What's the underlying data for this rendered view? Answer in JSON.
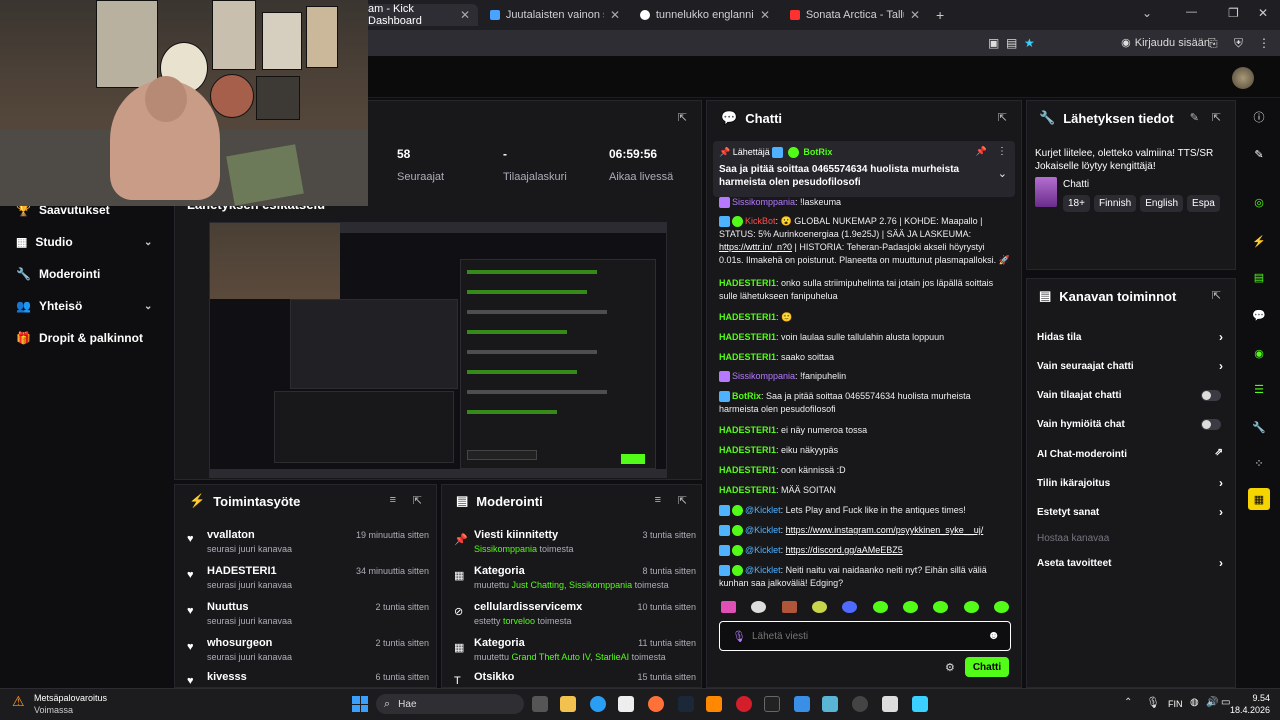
{
  "browser": {
    "tabs": [
      {
        "label": "am - Kick Dashboard",
        "close": "✕",
        "color": "#53fc18"
      },
      {
        "label": "Juutalaisten vainon syyt ja aikaj",
        "close": "✕",
        "color": "#4aa3ff"
      },
      {
        "label": "tunnelukko englanniksi - Googl",
        "close": "✕",
        "color": "#ffffff"
      },
      {
        "label": "Sonata Arctica - Tallulah - YouT",
        "close": "✕",
        "color": "#ff3030"
      }
    ],
    "new_tab": "+",
    "window": {
      "minimize": "—",
      "restore": "❐",
      "close": "✕",
      "dropdown": "⌄"
    },
    "signin": "Kirjaudu sisään"
  },
  "sidebar": {
    "items": [
      {
        "label": "Saavutukset",
        "icon": "trophy-icon"
      },
      {
        "label": "Studio",
        "icon": "studio-icon",
        "chevron": "⌄"
      },
      {
        "label": "Moderointi",
        "icon": "wrench-icon"
      },
      {
        "label": "Yhteisö",
        "icon": "people-icon",
        "chevron": "⌄"
      },
      {
        "label": "Dropit & palkinnot",
        "icon": "gift-icon"
      }
    ]
  },
  "stream_panel": {
    "expand": "⇱",
    "title": "Lähetyksen esikatselu",
    "stats": [
      {
        "value": "58",
        "label": "Seuraajat"
      },
      {
        "value": "-",
        "label": "Tilaajalaskuri"
      },
      {
        "value": "06:59:56",
        "label": "Aikaa livessä"
      }
    ]
  },
  "activity": {
    "title": "Toimintasyöte",
    "filter": "≡",
    "expand": "⇱",
    "items": [
      {
        "name": "vvallaton",
        "sub": "seurasi juuri kanavaa",
        "time": "19 minuuttia sitten"
      },
      {
        "name": "HADESTERI1",
        "sub": "seurasi juuri kanavaa",
        "time": "34 minuuttia sitten"
      },
      {
        "name": "Nuuttus",
        "sub": "seurasi juuri kanavaa",
        "time": "2 tuntia sitten"
      },
      {
        "name": "whosurgeon",
        "sub": "seurasi juuri kanavaa",
        "time": "2 tuntia sitten"
      },
      {
        "name": "kivesss",
        "sub": "",
        "time": "6 tuntia sitten"
      }
    ]
  },
  "moderation": {
    "title": "Moderointi",
    "filter": "≡",
    "expand": "⇱",
    "items": [
      {
        "title": "Viesti kiinnitetty",
        "pre": "",
        "hl": "Sissikomppania",
        "post": " toimesta",
        "time": "3 tuntia sitten"
      },
      {
        "title": "Kategoria",
        "pre": "muutettu ",
        "hl": "Just Chatting, Sissikomppania",
        "post": " toimesta",
        "time": "8 tuntia sitten"
      },
      {
        "title": "cellulardisservicemx",
        "pre": "estetty ",
        "hl": "torveloo",
        "post": " toimesta",
        "time": "10 tuntia sitten"
      },
      {
        "title": "Kategoria",
        "pre": "muutettu ",
        "hl": "Grand Theft Auto IV, StarlieAI",
        "post": " toimesta",
        "time": "11 tuntia sitten"
      },
      {
        "title": "Otsikko",
        "pre": "",
        "hl": "",
        "post": "",
        "time": "15 tuntia sitten"
      }
    ]
  },
  "chat": {
    "title": "Chatti",
    "expand": "⇱",
    "pinned": {
      "by": "Lähettäjä",
      "user": "BotRix",
      "text": "Saa ja pitää soittaa 0465574634 huolista murheista harmeista olen pesudofilosofi",
      "pin": "📌",
      "more": "⋮",
      "toggle": "⌄"
    },
    "messages": [
      {
        "user": "Sissikomppania",
        "sep": ": ",
        "text": "!laskeuma",
        "color": "purple"
      },
      {
        "user": "KickBot",
        "sep": ": ",
        "text": "😮 GLOBAL NUKEMAP 2.76 | KOHDE: Maapallo | STATUS: 5% Aurinkoenergiaa (1.9e25J) | SÄÄ JA LASKEUMA: ",
        "link": "https://wttr.in/_n?0",
        "tail": " | HISTORIA: Teheran-Padasjoki akseli höyrystyi 0.01s. Ilmakehä on poistunut. Planeetta on muuttunut plasmapalloksi. 🚀",
        "color": "red"
      },
      {
        "user": "HADESTERI1",
        "sep": ": ",
        "text": "onko sulla striimipuhelinta tai jotain jos läpällä soittais sulle lähetukseen fanipuhelua",
        "color": "green"
      },
      {
        "user": "HADESTERI1",
        "sep": ": ",
        "text": "🙂",
        "color": "green"
      },
      {
        "user": "HADESTERI1",
        "sep": ": ",
        "text": "voin laulaa sulle tallulahin alusta loppuun",
        "color": "green"
      },
      {
        "user": "HADESTERI1",
        "sep": ": ",
        "text": "saako soittaa",
        "color": "green"
      },
      {
        "user": "Sissikomppania",
        "sep": ": ",
        "text": "!fanipuhelin",
        "color": "purple"
      },
      {
        "user": "BotRix",
        "sep": ": ",
        "text": "Saa ja pitää soittaa 0465574634 huolista murheista harmeista olen pesudofilosofi",
        "color": "green"
      },
      {
        "user": "HADESTERI1",
        "sep": ": ",
        "text": "ei näy numeroa tossa",
        "color": "green"
      },
      {
        "user": "HADESTERI1",
        "sep": ": ",
        "text": "eiku näkyypäs",
        "color": "green"
      },
      {
        "user": "HADESTERI1",
        "sep": ": ",
        "text": "oon kännissä :D",
        "color": "green"
      },
      {
        "user": "HADESTERI1",
        "sep": ": ",
        "text": "MÄÄ SOITAN",
        "color": "green"
      },
      {
        "user": "@Kicklet",
        "sep": ": ",
        "text": "Lets Play and Fuck like in the antiques times!",
        "color": "blue"
      },
      {
        "user": "@Kicklet",
        "sep": ": ",
        "text": "",
        "link": "https://www.instagram.com/psyykkinen_syke__uj/",
        "color": "blue"
      },
      {
        "user": "@Kicklet",
        "sep": ": ",
        "text": "",
        "link": "https://discord.gg/aAMeEBZ5",
        "color": "blue"
      },
      {
        "user": "@Kicklet",
        "sep": ": ",
        "text": "Neiti naitu vai naidaanko neiti nyt? Eihän sillä väliä kunhan saa jalkoväliä! Edging?",
        "color": "blue"
      }
    ],
    "input_placeholder": "Lähetä viesti",
    "emoji": "☻",
    "settings": "⚙",
    "send": "Chatti"
  },
  "stream_info": {
    "title": "Lähetyksen tiedot",
    "edit": "✎",
    "expand": "⇱",
    "description": "Kurjet liitelee, oletteko valmiina! TTS/SR Jokaiselle löytyy kengittäjä!",
    "category": "Chatti",
    "tags": [
      "18+",
      "Finnish",
      "English",
      "Espa"
    ]
  },
  "channel_actions": {
    "title": "Kanavan toiminnot",
    "expand": "⇱",
    "items": [
      {
        "label": "Hidas tila",
        "type": "arrow"
      },
      {
        "label": "Vain seuraajat chatti",
        "type": "arrow"
      },
      {
        "label": "Vain tilaajat chatti",
        "type": "toggle"
      },
      {
        "label": "Vain hymiöitä chat",
        "type": "toggle"
      },
      {
        "label": "AI Chat-moderointi",
        "type": "external"
      },
      {
        "label": "Tilin ikärajoitus",
        "type": "arrow"
      },
      {
        "label": "Estetyt sanat",
        "type": "arrow"
      },
      {
        "label": "Hostaa kanavaa",
        "type": "disabled"
      },
      {
        "label": "Aseta tavoitteet",
        "type": "arrow"
      }
    ],
    "arrow": "›"
  },
  "taskbar": {
    "weather_title": "Metsäpalovaroitus",
    "weather_sub": "Voimassa",
    "search": "Hae",
    "lang": "FIN",
    "time": "9.54",
    "date": "18.4.2026"
  }
}
